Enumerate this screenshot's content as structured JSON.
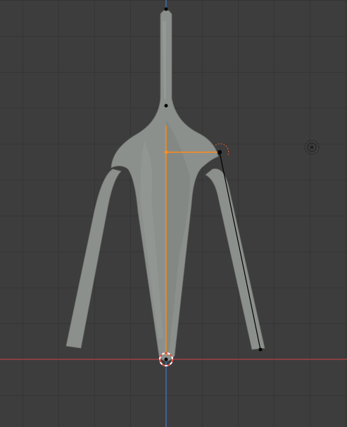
{
  "viewport": {
    "background": "#3d3d3d",
    "grid_color": "#353535"
  },
  "axes": {
    "x_axis_color": "#b8434a",
    "z_axis_color": "#4b7bc9"
  },
  "mesh": {
    "fill": "#8c908c",
    "shade": "#7a7e7a",
    "highlight": "#a3a7a3",
    "edge": "#6f726f"
  },
  "rig": {
    "selected_color": "#ff8c1a",
    "bone_color": "#000000"
  },
  "cursor_3d": {
    "ring_outer": "#ffffff",
    "ring_inner": "#e0403a"
  },
  "light_gizmo": {
    "icon": "light-icon",
    "color": "#222222"
  }
}
